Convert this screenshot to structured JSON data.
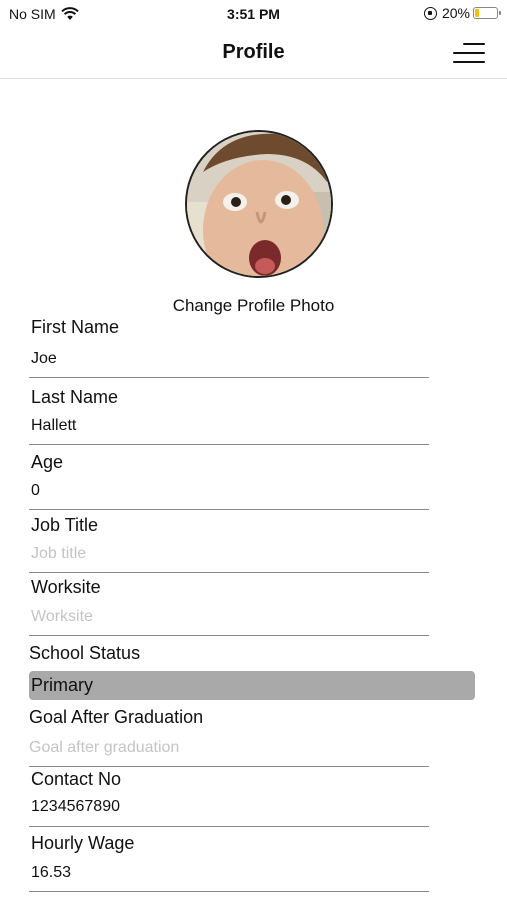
{
  "status_bar": {
    "carrier": "No SIM",
    "time": "3:51 PM",
    "battery_percent": "20%",
    "battery_level": 0.2,
    "icons": [
      "wifi-icon",
      "orientation-lock-icon",
      "battery-icon"
    ]
  },
  "nav": {
    "title": "Profile",
    "menu_icon": "hamburger-menu-icon"
  },
  "profile": {
    "change_photo_label": "Change Profile Photo"
  },
  "fields": {
    "first_name": {
      "label": "First Name",
      "value": "Joe"
    },
    "last_name": {
      "label": "Last Name",
      "value": "Hallett"
    },
    "age": {
      "label": "Age",
      "value": "0"
    },
    "job_title": {
      "label": "Job Title",
      "value": "",
      "placeholder": "Job title"
    },
    "worksite": {
      "label": "Worksite",
      "value": "",
      "placeholder": "Worksite"
    },
    "school_status": {
      "label": "School Status",
      "value": "Primary"
    },
    "goal": {
      "label": "Goal After Graduation",
      "value": "",
      "placeholder": "Goal after graduation"
    },
    "contact": {
      "label": "Contact No",
      "value": "1234567890"
    },
    "wage": {
      "label": "Hourly Wage",
      "value": "16.53"
    }
  },
  "colors": {
    "select_bg": "#a9a9a9",
    "placeholder": "#c4c4c4",
    "battery_fill": "#f2c200"
  }
}
